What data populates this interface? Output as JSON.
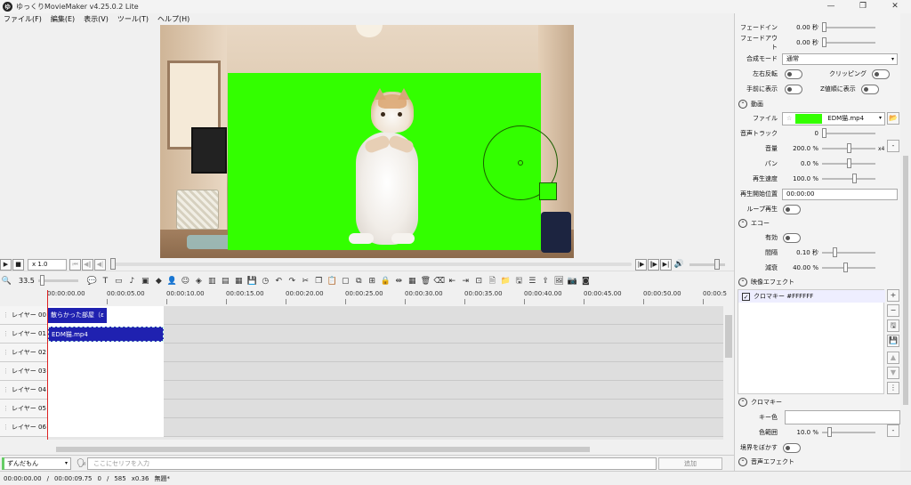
{
  "window": {
    "title": "ゆっくりMovieMaker v4.25.0.2 Lite",
    "app_icon": "ゆ",
    "controls": [
      "—",
      "❐",
      "✕"
    ]
  },
  "menu": [
    "ファイル(F)",
    "編集(E)",
    "表示(V)",
    "ツール(T)",
    "ヘルプ(H)"
  ],
  "playback": {
    "speed": "x 1.0",
    "seek_fraction": 0.0,
    "volume_fraction": 0.75
  },
  "toolbar": {
    "zoom_value": "33.5",
    "zoom_fraction": 0.05
  },
  "timeline": {
    "ticks": [
      "00:00:00.00",
      "00:00:05.00",
      "00:00:10.00",
      "00:00:15.00",
      "00:00:20.00",
      "00:00:25.00",
      "00:00:30.00",
      "00:00:35.00",
      "00:00:40.00",
      "00:00:45.00",
      "00:00:50.00",
      "00:00:5"
    ],
    "layers": [
      "レイヤー 00",
      "レイヤー 01",
      "レイヤー 02",
      "レイヤー 03",
      "レイヤー 04",
      "レイヤー 05",
      "レイヤー 06"
    ],
    "clips": [
      {
        "layer": 0,
        "label": "散らかった部屋（ε"
      },
      {
        "layer": 1,
        "label": "EDM猫.mp4"
      }
    ]
  },
  "input_bar": {
    "character": "ずんだもん",
    "placeholder": "ここにセリフを入力",
    "add_label": "追加"
  },
  "status": {
    "time": "00:00:00.00",
    "sep1": "/",
    "duration": "00:00:09.75",
    "frame": "0",
    "sep2": "/",
    "frames": "585",
    "zoom": "x0.36",
    "file": "無題*"
  },
  "inspector": {
    "fade_in": {
      "label": "フェードイン",
      "value": "0.00",
      "unit": "秒"
    },
    "fade_out": {
      "label": "フェードアウト",
      "value": "0.00",
      "unit": "秒"
    },
    "blend": {
      "label": "合成モード",
      "value": "通常"
    },
    "flip": {
      "label": "左右反転"
    },
    "clipping": {
      "label": "クリッピング"
    },
    "front": {
      "label": "手前に表示"
    },
    "zorder": {
      "label": "Z値順に表示"
    },
    "video_section": "動画",
    "file": {
      "label": "ファイル",
      "value": "EDM猫.mp4"
    },
    "audio_track": {
      "label": "音声トラック",
      "value": "0"
    },
    "volume": {
      "label": "音量",
      "value": "200.0",
      "unit": "%",
      "extra": "x4"
    },
    "pan": {
      "label": "パン",
      "value": "0.0",
      "unit": "%"
    },
    "speed": {
      "label": "再生速度",
      "value": "100.0",
      "unit": "%"
    },
    "start_pos": {
      "label": "再生開始位置",
      "value": "00:00:00"
    },
    "loop": {
      "label": "ループ再生"
    },
    "echo_section": "エコー",
    "echo_enabled": {
      "label": "有効"
    },
    "interval": {
      "label": "間隔",
      "value": "0.10",
      "unit": "秒"
    },
    "decay": {
      "label": "減衰",
      "value": "40.00",
      "unit": "%"
    },
    "video_effects_section": "映像エフェクト",
    "effect_item": "クロマキー #FFFFFF",
    "chroma_section": "クロマキー",
    "key_color": {
      "label": "キー色"
    },
    "color_range": {
      "label": "色範囲",
      "value": "10.0",
      "unit": "%"
    },
    "blur_edge": {
      "label": "境界をぼかす"
    },
    "audio_effects_section": "音声エフェクト"
  }
}
